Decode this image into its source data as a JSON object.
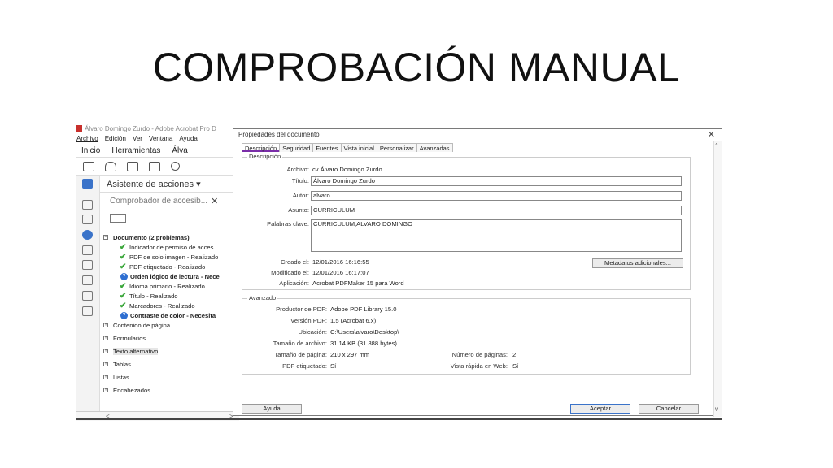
{
  "slide": {
    "title": "COMPROBACIÓN MANUAL"
  },
  "acrobat": {
    "window_title": "Álvaro Domingo Zurdo - Adobe Acrobat Pro D",
    "menu": [
      "Archivo",
      "Edición",
      "Ver",
      "Ventana",
      "Ayuda"
    ],
    "tabs": [
      "Inicio",
      "Herramientas",
      "Álva"
    ],
    "toolbar_icons": [
      "save-icon",
      "cloud-upload-icon",
      "print-icon",
      "email-icon",
      "search-icon"
    ],
    "panel_title": "Asistente de acciones ▾",
    "checker_title": "Comprobador de accesib...",
    "tree": [
      {
        "label": "Documento (2 problemas)",
        "kind": "section",
        "bold": true
      },
      {
        "label": "Indicador de permiso de acces",
        "kind": "check"
      },
      {
        "label": "PDF de solo imagen - Realizado",
        "kind": "check"
      },
      {
        "label": "PDF etiquetado - Realizado",
        "kind": "check"
      },
      {
        "label": "Orden lógico de lectura - Nece",
        "kind": "question",
        "bold": true
      },
      {
        "label": "Idioma primario - Realizado",
        "kind": "check"
      },
      {
        "label": "Título - Realizado",
        "kind": "check"
      },
      {
        "label": "Marcadores - Realizado",
        "kind": "check"
      },
      {
        "label": "Contraste de color - Necesita",
        "kind": "question",
        "bold": true
      },
      {
        "label": "Contenido de página",
        "kind": "section"
      },
      {
        "label": "Formularios",
        "kind": "section"
      },
      {
        "label": "Texto alternativo",
        "kind": "section",
        "highlight": true
      },
      {
        "label": "Tablas",
        "kind": "section"
      },
      {
        "label": "Listas",
        "kind": "section"
      },
      {
        "label": "Encabezados",
        "kind": "section"
      }
    ]
  },
  "dialog": {
    "title": "Propiedades del documento",
    "close": "✕",
    "tabs": [
      "Descripción",
      "Seguridad",
      "Fuentes",
      "Vista inicial",
      "Personalizar",
      "Avanzadas"
    ],
    "description_group": "Descripción",
    "fields": {
      "archivo_label": "Archivo:",
      "archivo_value": "cv Álvaro Domingo Zurdo",
      "titulo_label": "Título:",
      "titulo_value": "Álvaro Domingo Zurdo",
      "autor_label": "Autor:",
      "autor_value": "alvaro",
      "asunto_label": "Asunto:",
      "asunto_value": "CURRICULUM",
      "palabras_label": "Palabras clave:",
      "palabras_value": "CURRICULUM,ALVARO DOMINGO",
      "creado_label": "Creado el:",
      "creado_value": "12/01/2016 16:16:55",
      "modificado_label": "Modificado el:",
      "modificado_value": "12/01/2016 16:17:07",
      "aplicacion_label": "Aplicación:",
      "aplicacion_value": "Acrobat PDFMaker 15 para Word"
    },
    "metadata_button": "Metadatos adicionales...",
    "advanced_group": "Avanzado",
    "advanced": {
      "productor_label": "Productor de PDF:",
      "productor_value": "Adobe PDF Library 15.0",
      "version_label": "Versión PDF:",
      "version_value": "1.5 (Acrobat 6.x)",
      "ubicacion_label": "Ubicación:",
      "ubicacion_value": "C:\\Users\\alvaro\\Desktop\\",
      "tamano_archivo_label": "Tamaño de archivo:",
      "tamano_archivo_value": "31,14 KB (31.888 bytes)",
      "tamano_pagina_label": "Tamaño de página:",
      "tamano_pagina_value": "210 x 297 mm",
      "num_paginas_label": "Número de páginas:",
      "num_paginas_value": "2",
      "pdf_etiquetado_label": "PDF etiquetado:",
      "pdf_etiquetado_value": "Sí",
      "vista_rapida_label": "Vista rápida en Web:",
      "vista_rapida_value": "Sí"
    },
    "buttons": {
      "help": "Ayuda",
      "ok": "Aceptar",
      "cancel": "Cancelar"
    }
  }
}
